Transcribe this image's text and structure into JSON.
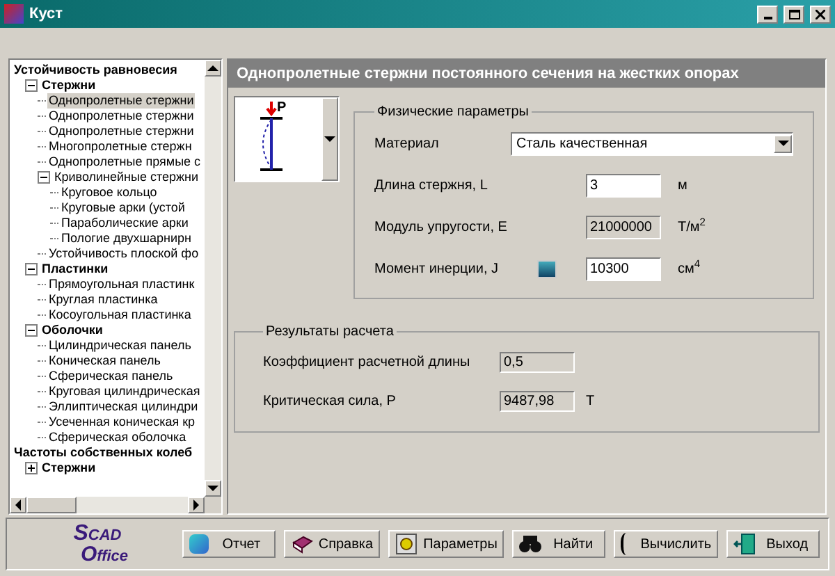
{
  "window": {
    "title": "Куст"
  },
  "tree": [
    {
      "label": "Устойчивость равновесия",
      "bold": true,
      "selected": false,
      "children": [
        {
          "label": "Стержни",
          "bold": true,
          "expanded": true,
          "selected": false,
          "children": [
            {
              "label": "Однопролетные стержни",
              "selected": true
            },
            {
              "label": "Однопролетные стержни",
              "selected": false
            },
            {
              "label": "Однопролетные стержни",
              "selected": false
            },
            {
              "label": "Многопролетные стержн",
              "selected": false
            },
            {
              "label": "Однопролетные прямые с",
              "selected": false
            },
            {
              "label": "Криволинейные стержни",
              "expanded": true,
              "selected": false,
              "children": [
                {
                  "label": "Круговое кольцо",
                  "selected": false
                },
                {
                  "label": "Круговые арки (устой",
                  "selected": false
                },
                {
                  "label": "Параболические арки",
                  "selected": false
                },
                {
                  "label": "Пологие двухшарнирн",
                  "selected": false
                }
              ]
            },
            {
              "label": "Устойчивость плоской фо",
              "selected": false
            }
          ]
        },
        {
          "label": "Пластинки",
          "bold": true,
          "expanded": true,
          "selected": false,
          "children": [
            {
              "label": "Прямоугольная пластинк",
              "selected": false
            },
            {
              "label": "Круглая пластинка",
              "selected": false
            },
            {
              "label": "Косоугольная пластинка",
              "selected": false
            }
          ]
        },
        {
          "label": "Оболочки",
          "bold": true,
          "expanded": true,
          "selected": false,
          "children": [
            {
              "label": "Цилиндрическая панель",
              "selected": false
            },
            {
              "label": "Коническая панель",
              "selected": false
            },
            {
              "label": "Сферическая панель",
              "selected": false
            },
            {
              "label": "Круговая цилиндрическая",
              "selected": false
            },
            {
              "label": "Эллиптическая цилиндри",
              "selected": false
            },
            {
              "label": "Усеченная коническая кр",
              "selected": false
            },
            {
              "label": "Сферическая оболочка",
              "selected": false
            }
          ]
        }
      ]
    },
    {
      "label": "Частоты собственных колеб",
      "bold": true,
      "selected": false,
      "children": [
        {
          "label": "Стержни",
          "bold": true,
          "expanded": false,
          "selected": false
        }
      ]
    }
  ],
  "header": "Однопролетные стержни постоянного сечения на жестких опорах",
  "scheme": {
    "load_label": "P"
  },
  "physical": {
    "title": "Физические параметры",
    "rows": [
      {
        "kind": "select",
        "label": "Материал",
        "value": "Сталь качественная"
      },
      {
        "kind": "input",
        "label": "Длина стержня, L",
        "value": "3",
        "unit": "м"
      },
      {
        "kind": "readonly",
        "label": "Модуль упругости, E",
        "value": "21000000",
        "unit": "Т/м$^{2}$"
      },
      {
        "kind": "input",
        "label": "Момент инерции, J",
        "value": "10300",
        "unit": "см$^{4}$",
        "calculator": true
      }
    ]
  },
  "results": {
    "title": "Результаты расчета",
    "rows": [
      {
        "label": "Коэффициент расчетной длины",
        "value": "0,5"
      },
      {
        "label": "Критическая сила, P",
        "value": "9487,98",
        "unit": "Т"
      }
    ]
  },
  "logo": {
    "first": "S",
    "top": "CAD",
    "second": "O",
    "bottom": "ffice"
  },
  "buttons": [
    {
      "kind": "report",
      "label": "Отчет"
    },
    {
      "kind": "help",
      "label": "Справка"
    },
    {
      "kind": "params",
      "label": "Параметры"
    },
    {
      "kind": "find",
      "label": "Найти"
    },
    {
      "kind": "calc",
      "label": "Вычислить"
    },
    {
      "kind": "exit",
      "label": "Выход"
    }
  ]
}
